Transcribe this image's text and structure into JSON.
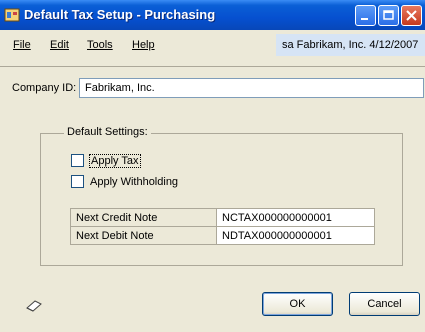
{
  "window": {
    "title": "Default Tax Setup - Purchasing"
  },
  "menu": {
    "file": "File",
    "edit": "Edit",
    "tools": "Tools",
    "help": "Help"
  },
  "user_info": "sa  Fabrikam, Inc.  4/12/2007",
  "company": {
    "label": "Company ID:",
    "value": "Fabrikam, Inc."
  },
  "default_settings": {
    "title": "Default Settings:",
    "apply_tax": {
      "label": "Apply Tax",
      "checked": false
    },
    "apply_withholding": {
      "label": "Apply Withholding",
      "checked": false
    }
  },
  "numbers": {
    "credit_label": "Next Credit Note",
    "credit_value": "NCTAX000000000001",
    "debit_label": "Next Debit Note",
    "debit_value": "NDTAX000000000001"
  },
  "buttons": {
    "ok": "OK",
    "cancel": "Cancel"
  }
}
